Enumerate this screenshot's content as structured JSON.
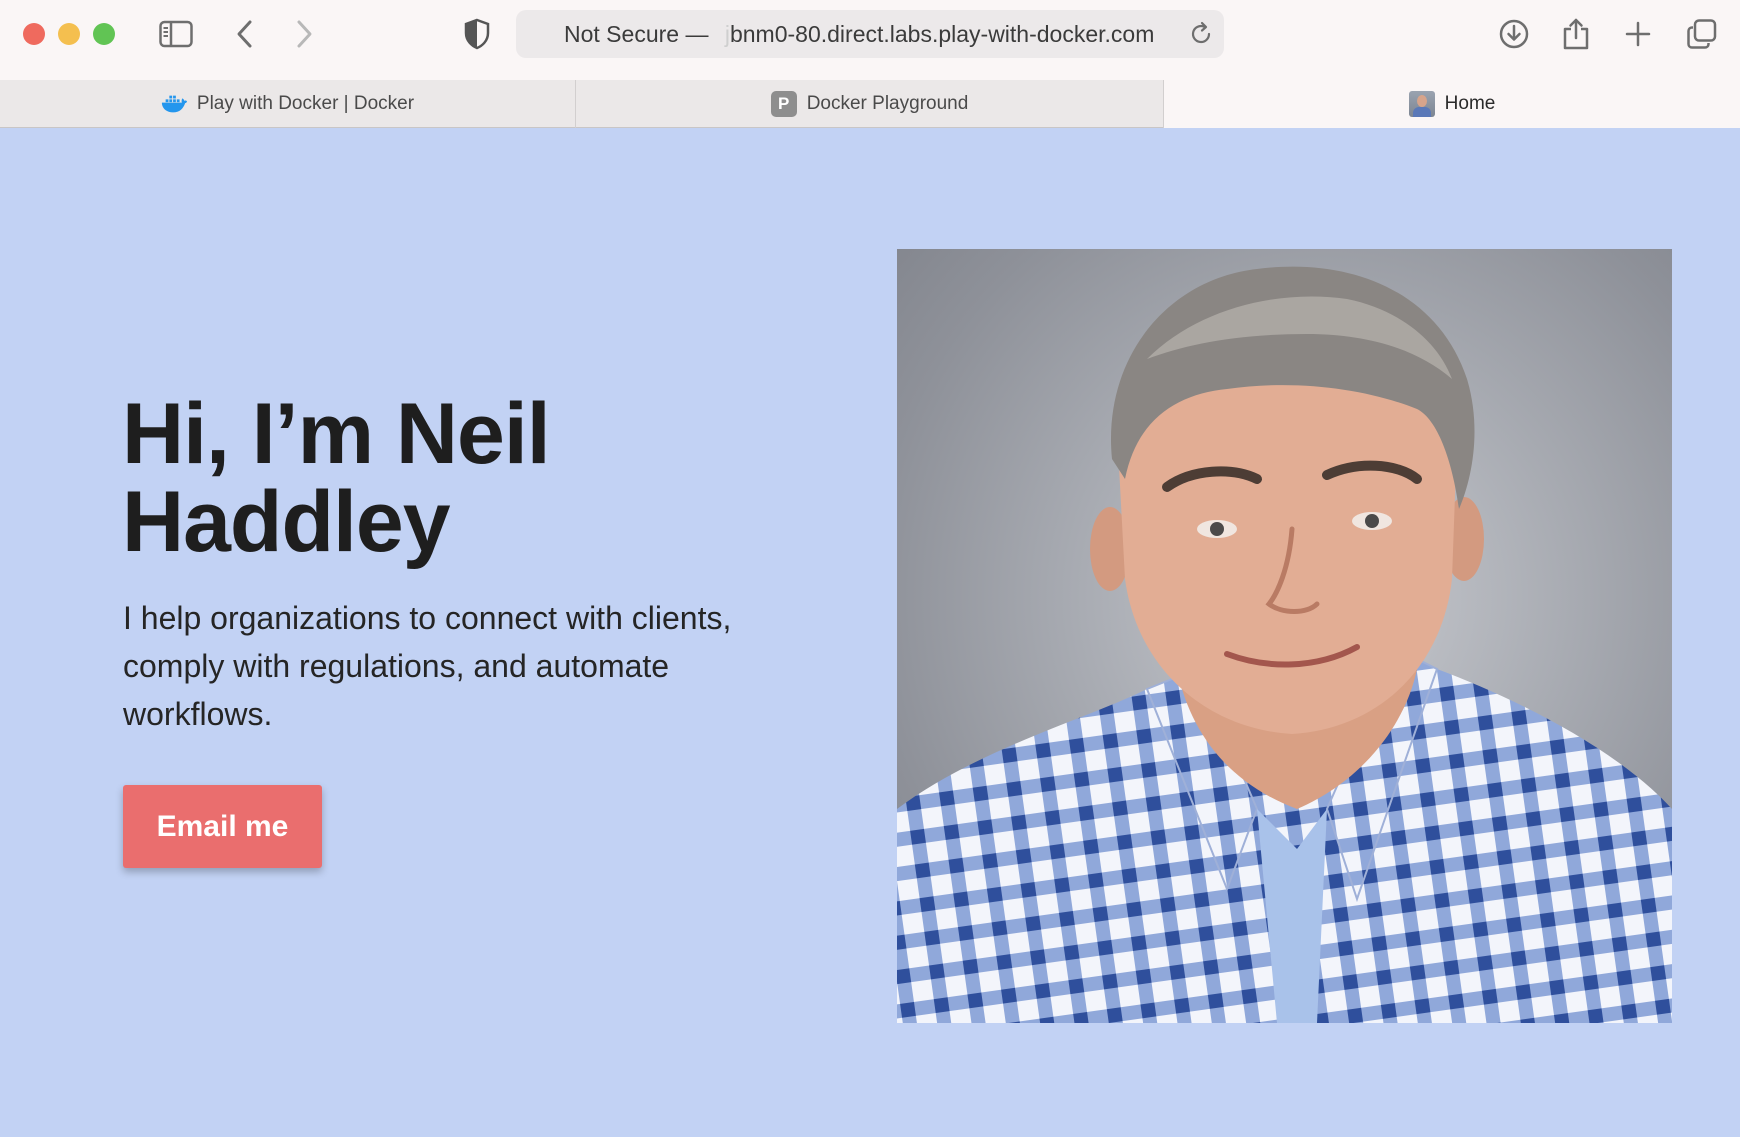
{
  "browser": {
    "address": {
      "security_label": "Not Secure",
      "separator": "—",
      "url_faded": "j",
      "url": "bnm0-80.direct.labs.play-with-docker.com"
    },
    "tabs": [
      {
        "label": "Play with Docker | Docker",
        "icon": "docker-whale-icon"
      },
      {
        "label": "Docker Playground",
        "icon": "p-letter-icon",
        "icon_text": "P"
      },
      {
        "label": "Home",
        "icon": "portrait-thumbnail-icon",
        "active": true
      }
    ]
  },
  "hero": {
    "title": "Hi, I’m Neil Haddley",
    "subtitle": "I help organizations to connect with clients, comply with regulations, and automate workflows.",
    "cta_label": "Email me",
    "cta_color": "#ea6e6e"
  },
  "colors": {
    "page_background": "#c2d2f4",
    "toolbar_background": "#faf6f6"
  }
}
